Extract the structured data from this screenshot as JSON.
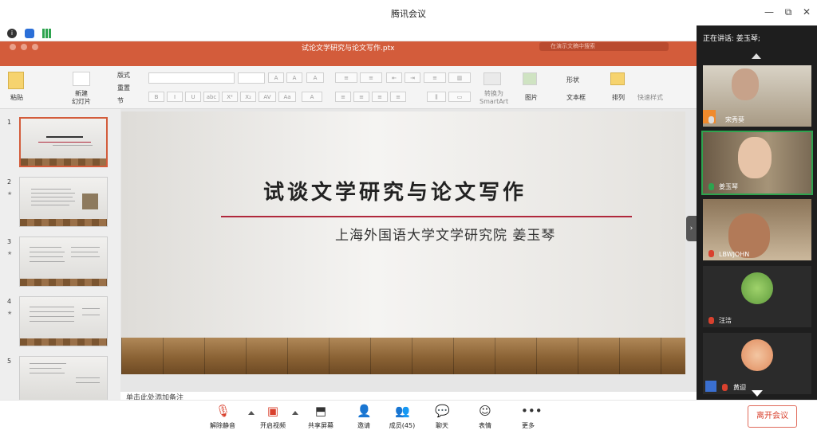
{
  "window": {
    "title": "腾讯会议",
    "minimize": "—",
    "restore": "⧉",
    "close": "✕"
  },
  "ppt": {
    "filename": "试论文学研究与论文写作.ptx",
    "search_placeholder": "在演示文稿中搜索",
    "ribbon": {
      "paste": "粘贴",
      "new_slide": "新建\n幻灯片",
      "layout": "版式",
      "reset": "重置",
      "section": "节",
      "convert_smartart": "转换为\nSmartArt",
      "picture": "图片",
      "shape": "形状",
      "textbox": "文本框",
      "arrange": "排列",
      "quick_style": "快速样式"
    },
    "thumbnails": [
      {
        "num": "1"
      },
      {
        "num": "2",
        "star": "★"
      },
      {
        "num": "3",
        "star": "★"
      },
      {
        "num": "4",
        "star": "★"
      },
      {
        "num": "5"
      }
    ],
    "slide": {
      "title": "试谈文学研究与论文写作",
      "subtitle": "上海外国语大学文学研究院   姜玉琴"
    },
    "notes_placeholder": "单击此处添加备注"
  },
  "panel": {
    "speaking": "正在讲话: 姜玉琴;",
    "participants": [
      {
        "name": "宋秀葵"
      },
      {
        "name": "姜玉琴"
      },
      {
        "name": "LBWJOHN"
      },
      {
        "name": "汪洁"
      },
      {
        "name": "黄迎"
      }
    ]
  },
  "toolbar": {
    "unmute": "解除静音",
    "start_video": "开启视频",
    "share_screen": "共享屏幕",
    "invite": "邀请",
    "members": "成员(45)",
    "chat": "聊天",
    "emoji": "表情",
    "more": "更多",
    "leave": "离开会议"
  },
  "colors": {
    "ppt_brand": "#d35c3b",
    "title_rule": "#b0283c",
    "speaking_border": "#2ea44f",
    "leave": "#d9412e"
  }
}
